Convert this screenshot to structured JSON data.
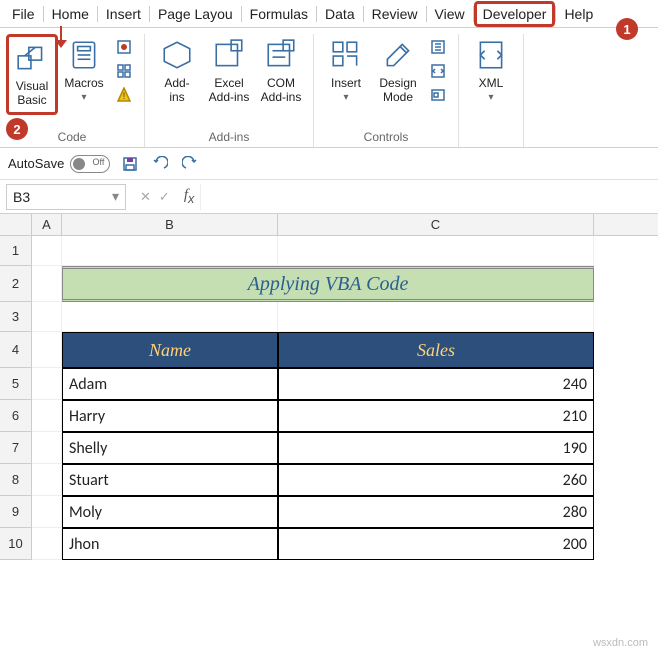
{
  "tabs": {
    "file": "File",
    "home": "Home",
    "insert": "Insert",
    "page_layout": "Page Layou",
    "formulas": "Formulas",
    "data": "Data",
    "review": "Review",
    "view": "View",
    "developer": "Developer",
    "help": "Help"
  },
  "callouts": {
    "one": "1",
    "two": "2"
  },
  "ribbon": {
    "code": {
      "group_label": "Code",
      "visual_basic": "Visual\nBasic",
      "macros": "Macros"
    },
    "addins": {
      "group_label": "Add-ins",
      "addins": "Add-\nins",
      "excel_addins": "Excel\nAdd-ins",
      "com_addins": "COM\nAdd-ins"
    },
    "controls": {
      "group_label": "Controls",
      "insert": "Insert",
      "design_mode": "Design\nMode"
    },
    "xml": {
      "label": "XML"
    }
  },
  "quick": {
    "autosave_label": "AutoSave",
    "autosave_state": "Off"
  },
  "namebox": {
    "value": "B3"
  },
  "sheet": {
    "cols": {
      "A": "A",
      "B": "B",
      "C": "C"
    },
    "row_nums": [
      "1",
      "2",
      "3",
      "4",
      "5",
      "6",
      "7",
      "8",
      "9",
      "10"
    ],
    "title": "Applying VBA Code",
    "headers": {
      "name": "Name",
      "sales": "Sales"
    },
    "data": [
      {
        "name": "Adam",
        "sales": "240"
      },
      {
        "name": "Harry",
        "sales": "210"
      },
      {
        "name": "Shelly",
        "sales": "190"
      },
      {
        "name": "Stuart",
        "sales": "260"
      },
      {
        "name": "Moly",
        "sales": "280"
      },
      {
        "name": "Jhon",
        "sales": "200"
      }
    ]
  },
  "watermark": "wsxdn.com"
}
